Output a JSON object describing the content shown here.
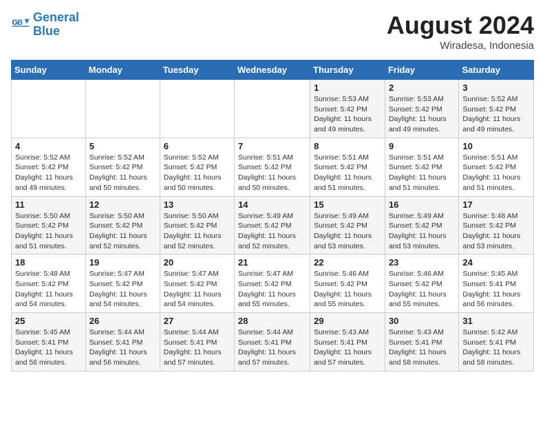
{
  "logo": {
    "line1": "General",
    "line2": "Blue"
  },
  "title": {
    "month_year": "August 2024",
    "location": "Wiradesa, Indonesia"
  },
  "days_of_week": [
    "Sunday",
    "Monday",
    "Tuesday",
    "Wednesday",
    "Thursday",
    "Friday",
    "Saturday"
  ],
  "weeks": [
    [
      {
        "day": "",
        "info": ""
      },
      {
        "day": "",
        "info": ""
      },
      {
        "day": "",
        "info": ""
      },
      {
        "day": "",
        "info": ""
      },
      {
        "day": "1",
        "info": "Sunrise: 5:53 AM\nSunset: 5:42 PM\nDaylight: 11 hours and 49 minutes."
      },
      {
        "day": "2",
        "info": "Sunrise: 5:53 AM\nSunset: 5:42 PM\nDaylight: 11 hours and 49 minutes."
      },
      {
        "day": "3",
        "info": "Sunrise: 5:52 AM\nSunset: 5:42 PM\nDaylight: 11 hours and 49 minutes."
      }
    ],
    [
      {
        "day": "4",
        "info": "Sunrise: 5:52 AM\nSunset: 5:42 PM\nDaylight: 11 hours and 49 minutes."
      },
      {
        "day": "5",
        "info": "Sunrise: 5:52 AM\nSunset: 5:42 PM\nDaylight: 11 hours and 50 minutes."
      },
      {
        "day": "6",
        "info": "Sunrise: 5:52 AM\nSunset: 5:42 PM\nDaylight: 11 hours and 50 minutes."
      },
      {
        "day": "7",
        "info": "Sunrise: 5:51 AM\nSunset: 5:42 PM\nDaylight: 11 hours and 50 minutes."
      },
      {
        "day": "8",
        "info": "Sunrise: 5:51 AM\nSunset: 5:42 PM\nDaylight: 11 hours and 51 minutes."
      },
      {
        "day": "9",
        "info": "Sunrise: 5:51 AM\nSunset: 5:42 PM\nDaylight: 11 hours and 51 minutes."
      },
      {
        "day": "10",
        "info": "Sunrise: 5:51 AM\nSunset: 5:42 PM\nDaylight: 11 hours and 51 minutes."
      }
    ],
    [
      {
        "day": "11",
        "info": "Sunrise: 5:50 AM\nSunset: 5:42 PM\nDaylight: 11 hours and 51 minutes."
      },
      {
        "day": "12",
        "info": "Sunrise: 5:50 AM\nSunset: 5:42 PM\nDaylight: 11 hours and 52 minutes."
      },
      {
        "day": "13",
        "info": "Sunrise: 5:50 AM\nSunset: 5:42 PM\nDaylight: 11 hours and 52 minutes."
      },
      {
        "day": "14",
        "info": "Sunrise: 5:49 AM\nSunset: 5:42 PM\nDaylight: 11 hours and 52 minutes."
      },
      {
        "day": "15",
        "info": "Sunrise: 5:49 AM\nSunset: 5:42 PM\nDaylight: 11 hours and 53 minutes."
      },
      {
        "day": "16",
        "info": "Sunrise: 5:49 AM\nSunset: 5:42 PM\nDaylight: 11 hours and 53 minutes."
      },
      {
        "day": "17",
        "info": "Sunrise: 5:48 AM\nSunset: 5:42 PM\nDaylight: 11 hours and 53 minutes."
      }
    ],
    [
      {
        "day": "18",
        "info": "Sunrise: 5:48 AM\nSunset: 5:42 PM\nDaylight: 11 hours and 54 minutes."
      },
      {
        "day": "19",
        "info": "Sunrise: 5:47 AM\nSunset: 5:42 PM\nDaylight: 11 hours and 54 minutes."
      },
      {
        "day": "20",
        "info": "Sunrise: 5:47 AM\nSunset: 5:42 PM\nDaylight: 11 hours and 54 minutes."
      },
      {
        "day": "21",
        "info": "Sunrise: 5:47 AM\nSunset: 5:42 PM\nDaylight: 11 hours and 55 minutes."
      },
      {
        "day": "22",
        "info": "Sunrise: 5:46 AM\nSunset: 5:42 PM\nDaylight: 11 hours and 55 minutes."
      },
      {
        "day": "23",
        "info": "Sunrise: 5:46 AM\nSunset: 5:42 PM\nDaylight: 11 hours and 55 minutes."
      },
      {
        "day": "24",
        "info": "Sunrise: 5:45 AM\nSunset: 5:41 PM\nDaylight: 11 hours and 56 minutes."
      }
    ],
    [
      {
        "day": "25",
        "info": "Sunrise: 5:45 AM\nSunset: 5:41 PM\nDaylight: 11 hours and 56 minutes."
      },
      {
        "day": "26",
        "info": "Sunrise: 5:44 AM\nSunset: 5:41 PM\nDaylight: 11 hours and 56 minutes."
      },
      {
        "day": "27",
        "info": "Sunrise: 5:44 AM\nSunset: 5:41 PM\nDaylight: 11 hours and 57 minutes."
      },
      {
        "day": "28",
        "info": "Sunrise: 5:44 AM\nSunset: 5:41 PM\nDaylight: 11 hours and 57 minutes."
      },
      {
        "day": "29",
        "info": "Sunrise: 5:43 AM\nSunset: 5:41 PM\nDaylight: 11 hours and 57 minutes."
      },
      {
        "day": "30",
        "info": "Sunrise: 5:43 AM\nSunset: 5:41 PM\nDaylight: 11 hours and 58 minutes."
      },
      {
        "day": "31",
        "info": "Sunrise: 5:42 AM\nSunset: 5:41 PM\nDaylight: 11 hours and 58 minutes."
      }
    ]
  ]
}
